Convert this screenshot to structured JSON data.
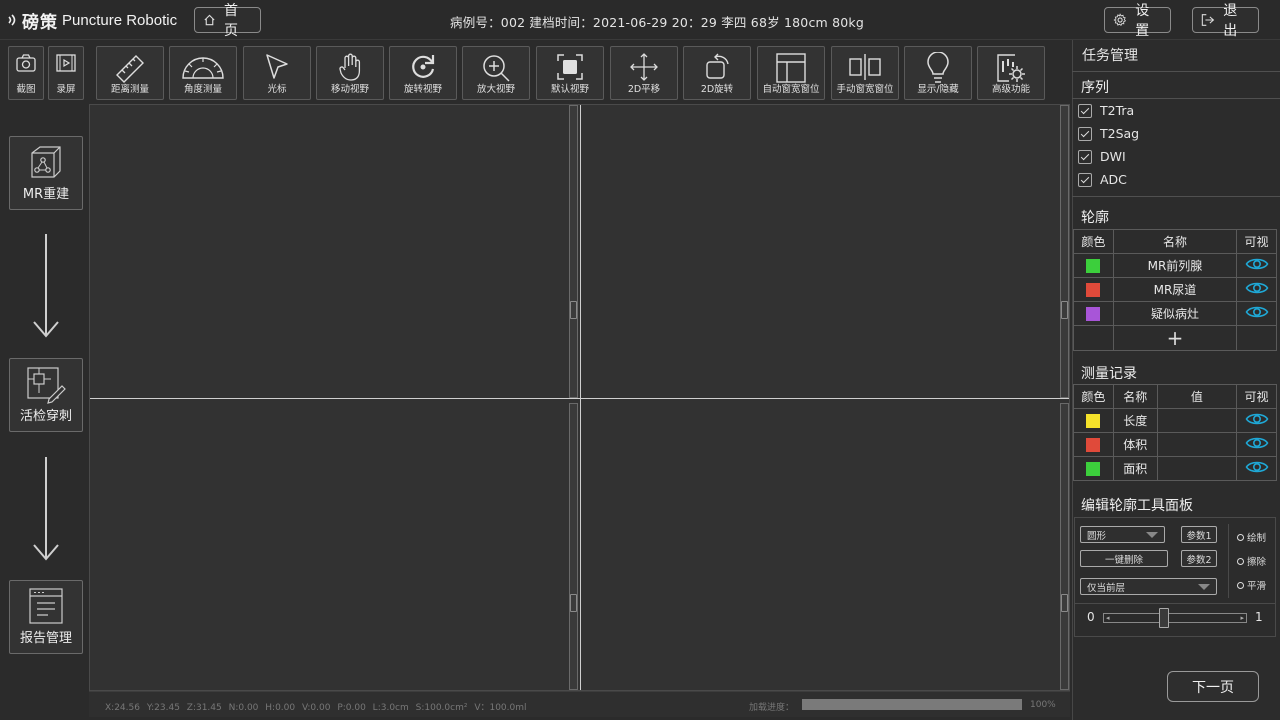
{
  "header": {
    "logo_cn": "磅策",
    "logo_en": "Puncture Robotic",
    "home_label": "首页",
    "patient_info": "病例号：002    建档时间：2021-06-29   20：29   李四 68岁 180cm 80kg",
    "settings_label": "设置",
    "exit_label": "退出"
  },
  "toolbar": {
    "screenshot": "截图",
    "record": "录屏",
    "distance": "距离测量",
    "angle": "角度测量",
    "cursor": "光标",
    "pan_view": "移动视野",
    "rotate_view": "旋转视野",
    "zoom_view": "放大视野",
    "default_view": "默认视野",
    "pan2d": "2D平移",
    "rotate2d": "2D旋转",
    "auto_window": "自动窗宽窗位",
    "manual_window": "手动窗宽窗位",
    "show_hide": "显示/隐藏",
    "advanced": "高级功能"
  },
  "workflow": {
    "mr_recon": "MR重建",
    "biopsy": "活检穿刺",
    "report": "报告管理"
  },
  "status": {
    "coords": "X:24.56   Y:23.45   Z:31.45   N:0.00   H:0.00   V:0.00   P:0.00   L:3.0cm   S:100.0cm²   V：100.0ml",
    "load_label": "加载进度：",
    "load_progress": 1.0,
    "load_pct": "100%"
  },
  "panel": {
    "title": "任务管理",
    "sequence_title": "序列",
    "sequences": [
      "T2Tra",
      "T2Sag",
      "DWI",
      "ADC"
    ],
    "contour_title": "轮廓",
    "contour_headers": {
      "color": "颜色",
      "name": "名称",
      "visible": "可视"
    },
    "contours": [
      {
        "name": "MR前列腺",
        "color": "#3ccf3c"
      },
      {
        "name": "MR尿道",
        "color": "#e04a3a"
      },
      {
        "name": "疑似病灶",
        "color": "#a855d8"
      }
    ],
    "add_symbol": "+",
    "measure_title": "测量记录",
    "measure_headers": {
      "color": "颜色",
      "name": "名称",
      "value": "值",
      "visible": "可视"
    },
    "measures": [
      {
        "name": "长度",
        "value": "",
        "color": "#f5e22a"
      },
      {
        "name": "体积",
        "value": "",
        "color": "#e04a3a"
      },
      {
        "name": "面积",
        "value": "",
        "color": "#3ccf3c"
      }
    ],
    "edit_title": "编辑轮廓工具面板",
    "shape_select": "圆形",
    "param1": "参数1",
    "clear_all": "一键删除",
    "param2": "参数2",
    "layer_select": "仅当前层",
    "radio_draw": "绘制",
    "radio_erase": "擦除",
    "radio_smooth": "平滑",
    "slider_min": "0",
    "slider_max": "1",
    "slider_value": 0.4,
    "next_label": "下一页",
    "eye_color": "#1fa8d6"
  }
}
